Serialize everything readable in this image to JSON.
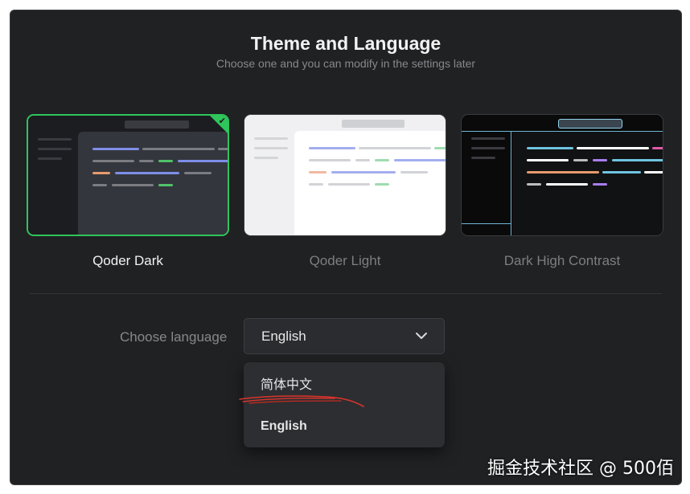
{
  "header": {
    "title": "Theme and Language",
    "subtitle": "Choose one and you can modify in the settings later"
  },
  "themes": [
    {
      "label": "Qoder Dark",
      "selected": true,
      "label_color": "#f2f2f2"
    },
    {
      "label": "Qoder Light",
      "selected": false,
      "label_color": "#7c7e82"
    },
    {
      "label": "Dark High Contrast",
      "selected": false,
      "label_color": "#7c7e82"
    }
  ],
  "language": {
    "label": "Choose language",
    "selected": "English",
    "options": [
      "简体中文",
      "English"
    ]
  },
  "colors": {
    "accent": "#2fc55b",
    "dialog_bg": "#202123",
    "annotation_red": "#d9342b"
  },
  "icons": {
    "selected_check": "check-icon",
    "dropdown": "chevron-down-icon"
  },
  "watermark": "掘金技术社区 @ 500佰"
}
